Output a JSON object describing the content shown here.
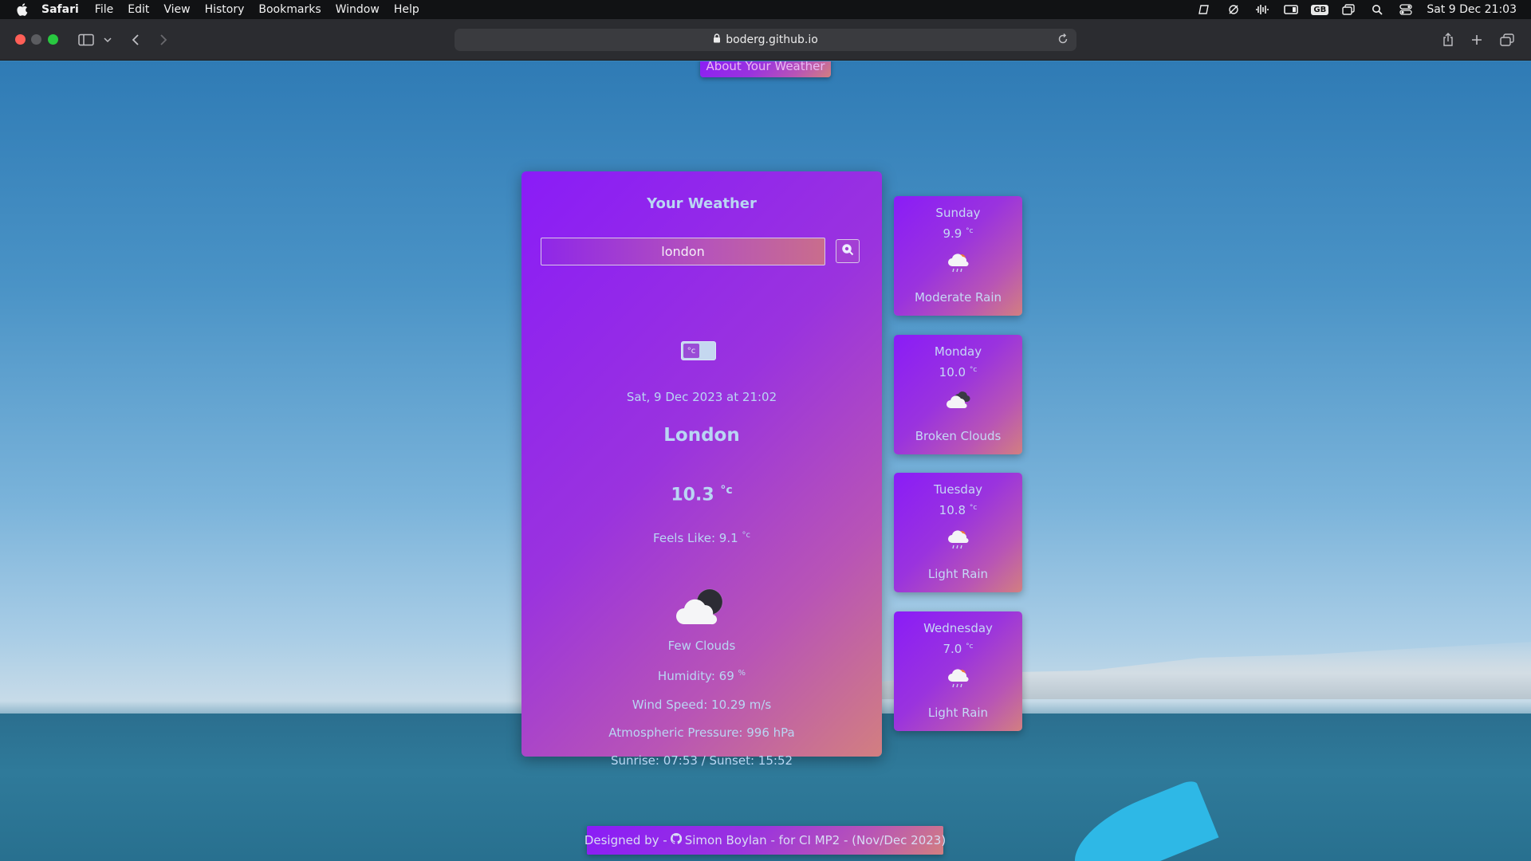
{
  "menubar": {
    "app_name": "Safari",
    "items": [
      "File",
      "Edit",
      "View",
      "History",
      "Bookmarks",
      "Window",
      "Help"
    ],
    "keyboard_layout": "GB",
    "clock": "Sat 9 Dec  21:03"
  },
  "browser": {
    "url": "boderg.github.io"
  },
  "page": {
    "about_button": "About Your Weather",
    "main": {
      "title": "Your Weather",
      "search_value": "london",
      "unit_toggle_label": "°c",
      "date": "Sat, 9 Dec 2023 at 21:02",
      "city": "London",
      "temp": "10.3",
      "temp_unit": "°c",
      "feels_like": "Feels Like: 9.1",
      "feels_unit": "°c",
      "description": "Few Clouds",
      "humidity": "Humidity: 69",
      "humidity_unit": "%",
      "wind": "Wind Speed: 10.29 m/s",
      "pressure": "Atmospheric Pressure: 996 hPa",
      "sun": "Sunrise: 07:53 / Sunset: 15:52",
      "icon": "few-clouds-night-icon"
    },
    "forecast": [
      {
        "day": "Sunday",
        "temp": "9.9",
        "unit": "°c",
        "icon": "rain-cloud-icon",
        "description": "Moderate Rain"
      },
      {
        "day": "Monday",
        "temp": "10.0",
        "unit": "°c",
        "icon": "broken-clouds-icon",
        "description": "Broken Clouds"
      },
      {
        "day": "Tuesday",
        "temp": "10.8",
        "unit": "°c",
        "icon": "rain-cloud-icon",
        "description": "Light Rain"
      },
      {
        "day": "Wednesday",
        "temp": "7.0",
        "unit": "°c",
        "icon": "rain-cloud-icon",
        "description": "Light Rain"
      }
    ],
    "footer": {
      "prefix": "Designed by -",
      "name": "Simon Boylan - for CI MP2 - (Nov/Dec 2023)"
    }
  }
}
